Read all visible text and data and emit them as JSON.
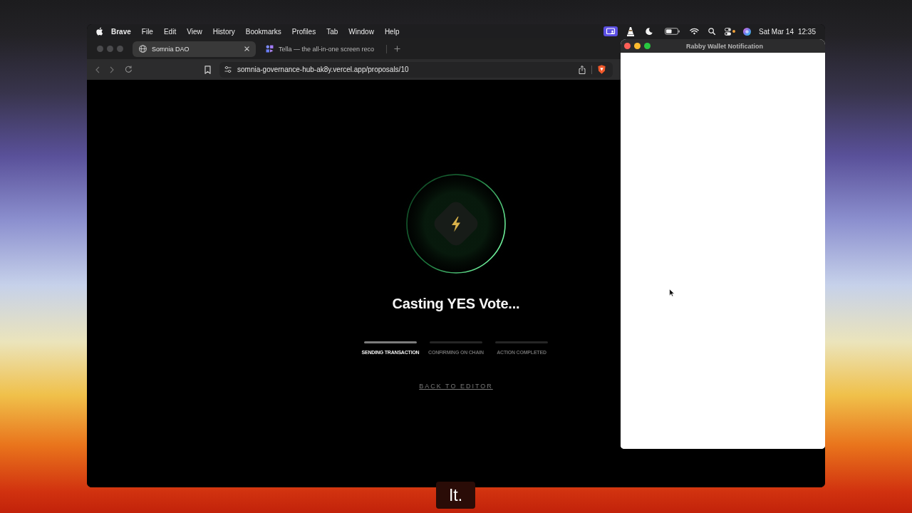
{
  "menu_bar": {
    "app_name": "Brave",
    "menus": [
      "File",
      "Edit",
      "View",
      "History",
      "Bookmarks",
      "Profiles",
      "Tab",
      "Window",
      "Help"
    ],
    "date": "Sat Mar 14",
    "time": "12:35"
  },
  "browser": {
    "focused": false,
    "tabs": [
      {
        "title": "Somnia DAO",
        "kind": "site",
        "selected": true
      },
      {
        "title": "Tella — the all-in-one screen reco",
        "kind": "app",
        "selected": false
      }
    ],
    "address_bar": {
      "url": "somnia-governance-hub-ak8y.vercel.app/proposals/10"
    },
    "page": {
      "heading": "Casting YES Vote...",
      "steps": [
        {
          "label": "SENDING TRANSACTION",
          "active": true
        },
        {
          "label": "CONFIRMING ON CHAIN",
          "active": false
        },
        {
          "label": "ACTION COMPLETED",
          "active": false
        }
      ],
      "back_link": "BACK TO EDITOR"
    }
  },
  "wallet_window": {
    "title": "Rabby Wallet Notification",
    "focused": true
  },
  "caption": "It."
}
